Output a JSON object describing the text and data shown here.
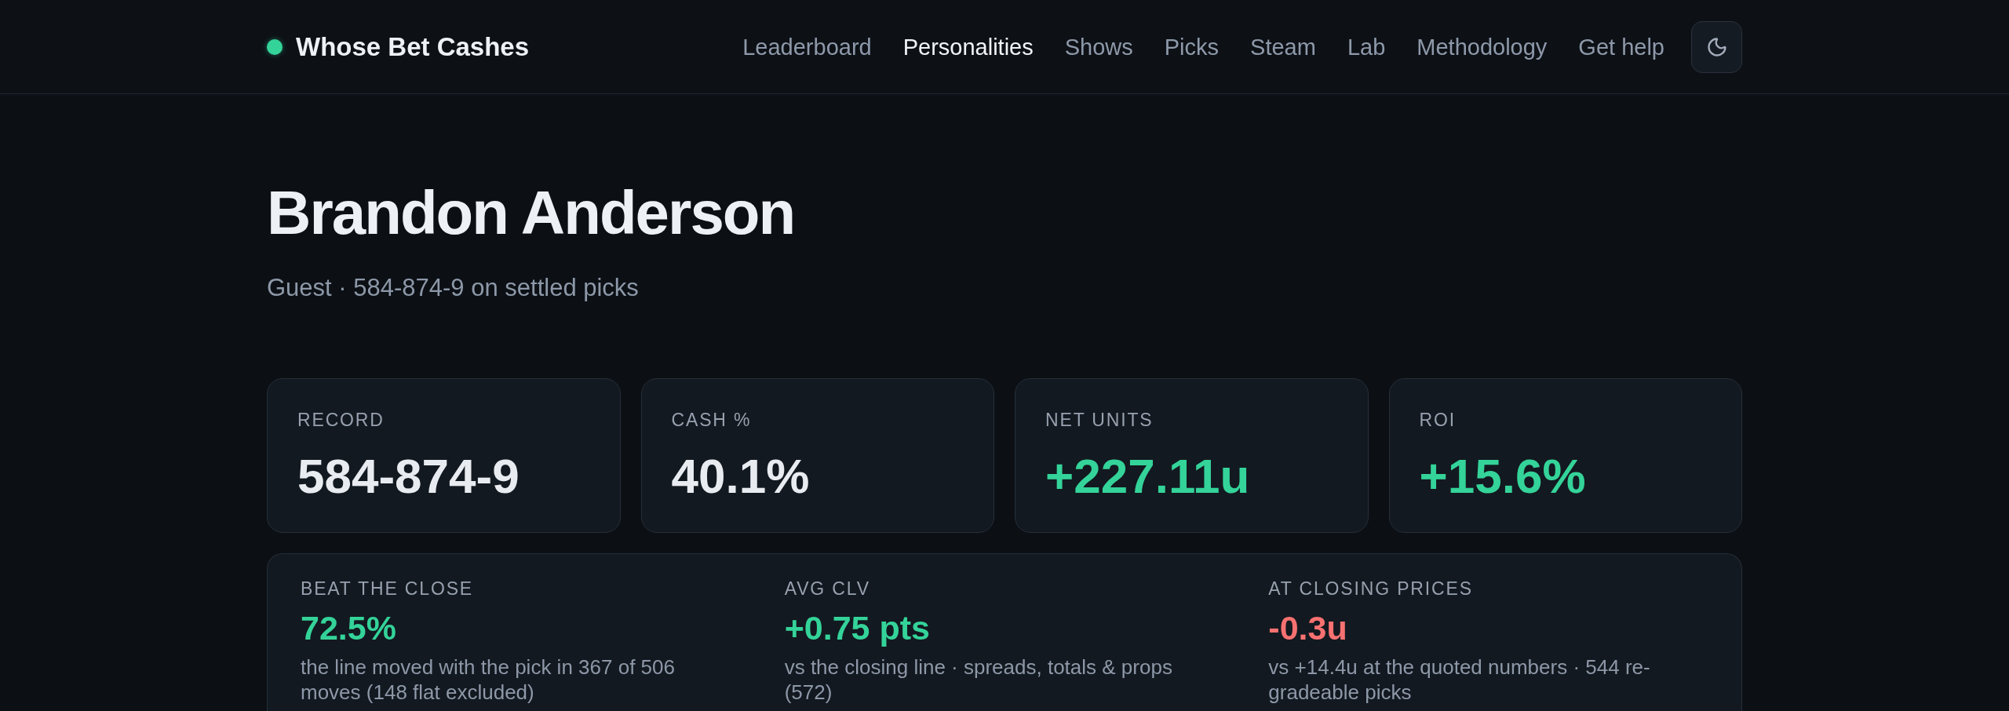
{
  "header": {
    "logo": {
      "text": "Whose Bet Cashes"
    },
    "nav": [
      {
        "label": "Leaderboard",
        "selected": false
      },
      {
        "label": "Personalities",
        "selected": true
      },
      {
        "label": "Shows",
        "selected": false
      },
      {
        "label": "Picks",
        "selected": false
      },
      {
        "label": "Steam",
        "selected": false
      },
      {
        "label": "Lab",
        "selected": false
      },
      {
        "label": "Methodology",
        "selected": false
      },
      {
        "label": "Get help",
        "selected": false
      }
    ]
  },
  "profile": {
    "name": "Brandon Anderson",
    "subtitle": "Guest · 584-874-9 on settled picks"
  },
  "stats": [
    {
      "label": "RECORD",
      "value": "584-874-9",
      "color": "#e8ecf1"
    },
    {
      "label": "CASH %",
      "value": "40.1%",
      "color": "#e8ecf1"
    },
    {
      "label": "NET UNITS",
      "value": "+227.11u",
      "color": "#34d399"
    },
    {
      "label": "ROI",
      "value": "+15.6%",
      "color": "#34d399"
    }
  ],
  "clv_panel": {
    "metrics": [
      {
        "label": "BEAT THE CLOSE",
        "value": "72.5%",
        "color": "#34d399",
        "note": "the line moved with the pick in 367 of 506 moves (148 flat excluded)"
      },
      {
        "label": "AVG CLV",
        "value": "+0.75 pts",
        "color": "#34d399",
        "note": "vs the closing line · spreads, totals & props (572)"
      },
      {
        "label": "AT CLOSING PRICES",
        "value": "-0.3u",
        "color": "#f87171",
        "note": "vs +14.4u at the quoted numbers · 544 re-gradeable picks"
      }
    ]
  }
}
